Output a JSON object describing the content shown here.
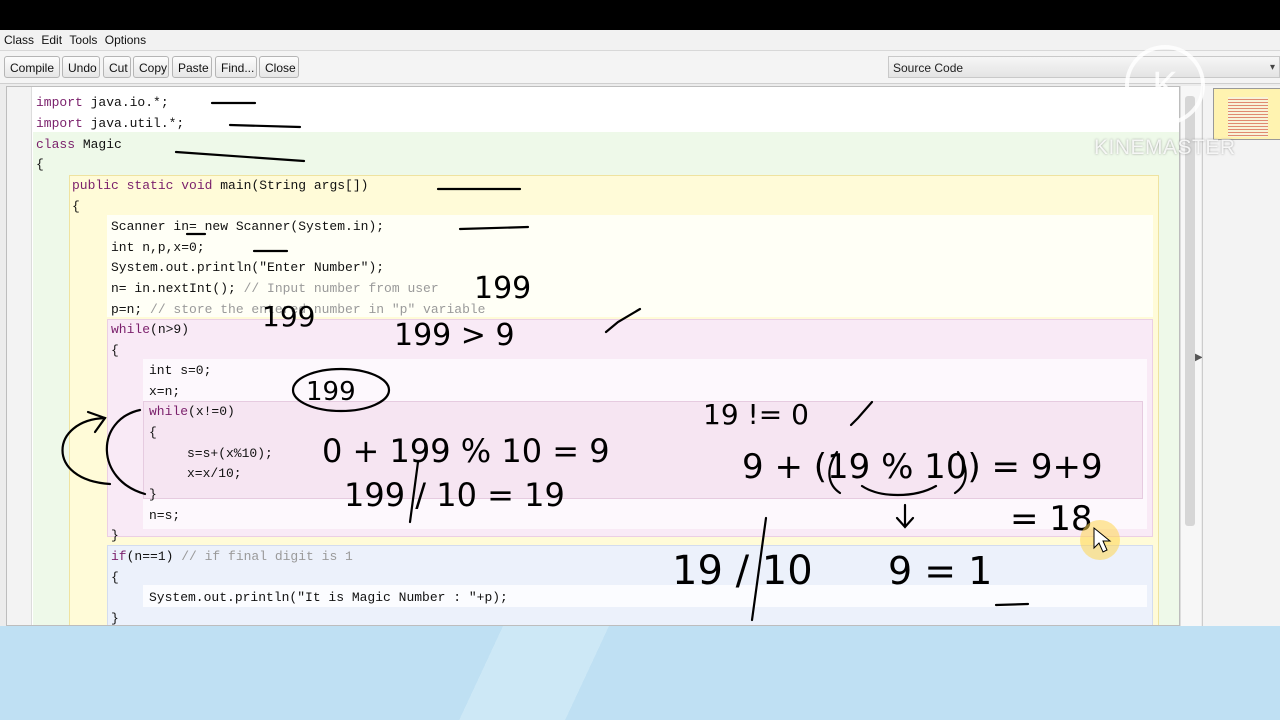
{
  "menu": [
    "Class",
    "Edit",
    "Tools",
    "Options"
  ],
  "toolbar": {
    "compile": "Compile",
    "undo": "Undo",
    "cut": "Cut",
    "copy": "Copy",
    "paste": "Paste",
    "find": "Find...",
    "close": "Close",
    "view_selector": "Source Code"
  },
  "code": [
    "import java.io.*;",
    "import java.util.*;",
    "class Magic",
    "{",
    "public static void main(String args[])",
    "{",
    "Scanner in= new Scanner(System.in);",
    "int n,p,x=0;",
    "System.out.println(\"Enter Number\");",
    "n= in.nextInt(); // Input number from user",
    "p=n; // store the entered number in \"p\" variable",
    "while(n>9)",
    "{",
    "int s=0;",
    "x=n;",
    "while(x!=0)",
    "{",
    "s=s+(x%10);",
    "x=x/10;",
    "}",
    "n=s;",
    "}",
    "if(n==1) // if final digit is 1",
    "{",
    "System.out.println(\"It is Magic Number : \"+p);",
    "}"
  ],
  "annotations": {
    "a1": "199",
    "a2": "199",
    "a3": "199 > 9",
    "a4": "199",
    "a5": "19 != 0",
    "a6": "0 + 199 % 10 = 9",
    "a7": "199 / 10 = 19",
    "a8": "9 + (19 % 10) = 9+9",
    "a9": "= 18",
    "a10": "19 / 10",
    "a11": "9 = 1"
  },
  "watermark": {
    "text": "KINEMASTER",
    "logo_letter": "K"
  }
}
